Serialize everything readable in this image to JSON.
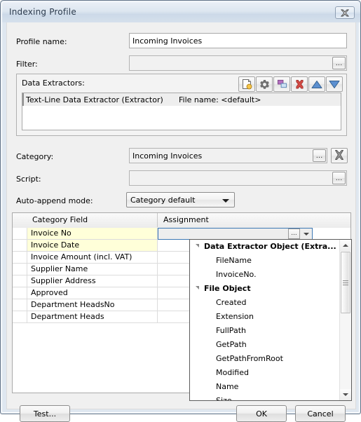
{
  "window": {
    "title": "Indexing Profile",
    "close_icon": "close-x-icon"
  },
  "form": {
    "profile_name_label": "Profile name:",
    "profile_name_value": "Incoming Invoices",
    "filter_label": "Filter:",
    "filter_value": "",
    "filter_browse_label": "...",
    "category_label": "Category:",
    "category_value": "Incoming Invoices",
    "category_browse_label": "...",
    "category_clear_icon": "clear-x-icon",
    "script_label": "Script:",
    "script_value": "",
    "script_browse_label": "...",
    "auto_append_label": "Auto-append mode:",
    "auto_append_value": "Category default"
  },
  "extractors": {
    "group_title": "Data Extractors:",
    "toolbar": [
      {
        "name": "new-extractor-icon",
        "title": "New"
      },
      {
        "name": "settings-gear-icon",
        "title": "Properties"
      },
      {
        "name": "duplicate-icon",
        "title": "Duplicate"
      },
      {
        "name": "delete-red-x-icon",
        "title": "Delete"
      },
      {
        "name": "move-up-icon",
        "title": "Move up"
      },
      {
        "name": "move-down-icon",
        "title": "Move down"
      }
    ],
    "items": [
      {
        "name": "Text-Line Data Extractor (Extractor)",
        "file": "File name: <default>"
      }
    ]
  },
  "grid": {
    "columns": [
      "Category Field",
      "Assignment"
    ],
    "rows": [
      {
        "field": "Invoice No",
        "assignment": "",
        "highlighted": true
      },
      {
        "field": "Invoice Date",
        "assignment": "",
        "highlighted": true
      },
      {
        "field": "Invoice Amount (incl. VAT)",
        "assignment": "",
        "highlighted": false
      },
      {
        "field": "Supplier Name",
        "assignment": "",
        "highlighted": false
      },
      {
        "field": "Supplier Address",
        "assignment": "",
        "highlighted": false
      },
      {
        "field": "Approved",
        "assignment": "",
        "highlighted": false
      },
      {
        "field": "Department HeadsNo",
        "assignment": "",
        "highlighted": false
      },
      {
        "field": "Department Heads",
        "assignment": "",
        "highlighted": false
      }
    ],
    "editor": {
      "value": "",
      "browse_label": "...",
      "dropdown_icon": "chevron-down-icon"
    }
  },
  "dropdown": {
    "items": [
      {
        "label": "Data Extractor Object (Extra...",
        "type": "group"
      },
      {
        "label": "FileName",
        "type": "leaf"
      },
      {
        "label": "InvoiceNo.",
        "type": "leaf"
      },
      {
        "label": "File Object",
        "type": "group"
      },
      {
        "label": "Created",
        "type": "leaf"
      },
      {
        "label": "Extension",
        "type": "leaf"
      },
      {
        "label": "FullPath",
        "type": "leaf"
      },
      {
        "label": "GetPath",
        "type": "leaf"
      },
      {
        "label": "GetPathFromRoot",
        "type": "leaf"
      },
      {
        "label": "Modified",
        "type": "leaf"
      },
      {
        "label": "Name",
        "type": "leaf"
      },
      {
        "label": "Size",
        "type": "leaf"
      }
    ],
    "scroll_up_icon": "scroll-up-arrow-icon",
    "scroll_down_icon": "scroll-down-arrow-icon"
  },
  "buttons": {
    "test": "Test...",
    "ok": "OK",
    "cancel": "Cancel"
  },
  "colors": {
    "highlight_row": "#ffffd9",
    "accent_border": "#3c78b4",
    "delete_red": "#d24a44",
    "arrow_blue": "#5b8fd0",
    "title_text": "#2b3a4d"
  }
}
